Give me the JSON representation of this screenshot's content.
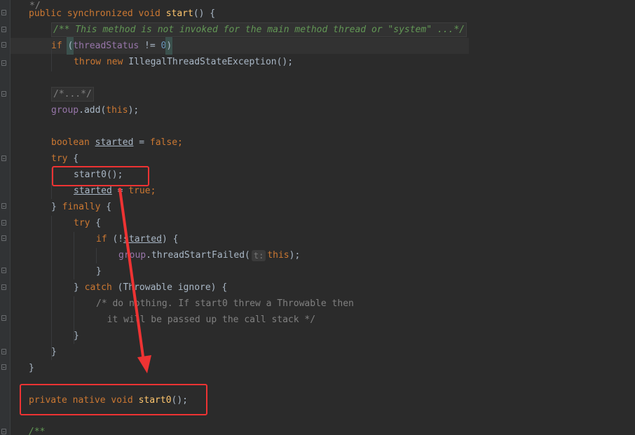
{
  "colors": {
    "background": "#2b2b2b",
    "keyword": "#cc7832",
    "method_name": "#ffc66d",
    "field": "#9876aa",
    "number": "#6897bb",
    "comment": "#808080",
    "doc_comment": "#629755",
    "annotation_red": "#ee3333"
  },
  "code": {
    "l1": {
      "kw1": "public",
      "kw2": "synchronized",
      "kw3": "void",
      "name": "start",
      "rest": "() {"
    },
    "l2": {
      "doc": "/** This method is not invoked for the main method thread or \"system\" ...*/"
    },
    "l3": {
      "kw": "if",
      "open": "(",
      "field": "threadStatus",
      "op": " != ",
      "num": "0",
      "close": ")"
    },
    "l4": {
      "kw1": "throw",
      "kw2": "new",
      "rest": "IllegalThreadStateException();"
    },
    "l6": {
      "cmt": "/*...*/"
    },
    "l7": {
      "field": "group",
      "mid": ".add(",
      "kw": "this",
      "end": ");"
    },
    "l9": {
      "kw": "boolean",
      "var": "started",
      "op": " = ",
      "val": "false",
      "semi": ";"
    },
    "l10": {
      "kw": "try",
      "rest": " {"
    },
    "l11": {
      "call": "start0();"
    },
    "l12": {
      "var": "started",
      "op": " = ",
      "val": "true",
      "semi": ";"
    },
    "l13": {
      "open": "} ",
      "kw": "finally",
      "rest": " {"
    },
    "l14": {
      "kw": "try",
      "rest": " {"
    },
    "l15": {
      "kw": "if",
      "open": " (!",
      "var": "started",
      "rest": ") {"
    },
    "l16": {
      "field": "group",
      "mid": ".threadStartFailed(",
      "hint": "t:",
      "kw": "this",
      "end": ");"
    },
    "l17": {
      "brace": "}"
    },
    "l18": {
      "open": "} ",
      "kw": "catch",
      "rest": " (Throwable ignore) {"
    },
    "l19": {
      "cmt": "/* do nothing. If start0 threw a Throwable then"
    },
    "l20": {
      "cmt": "  it will be passed up the call stack */"
    },
    "l21": {
      "brace": "}"
    },
    "l22": {
      "brace": "}"
    },
    "l23": {
      "brace": "}"
    },
    "l25": {
      "kw1": "private",
      "kw2": "native",
      "kw3": "void",
      "name": "start0",
      "rest": "();"
    },
    "l27": {
      "doc": "/**"
    }
  }
}
